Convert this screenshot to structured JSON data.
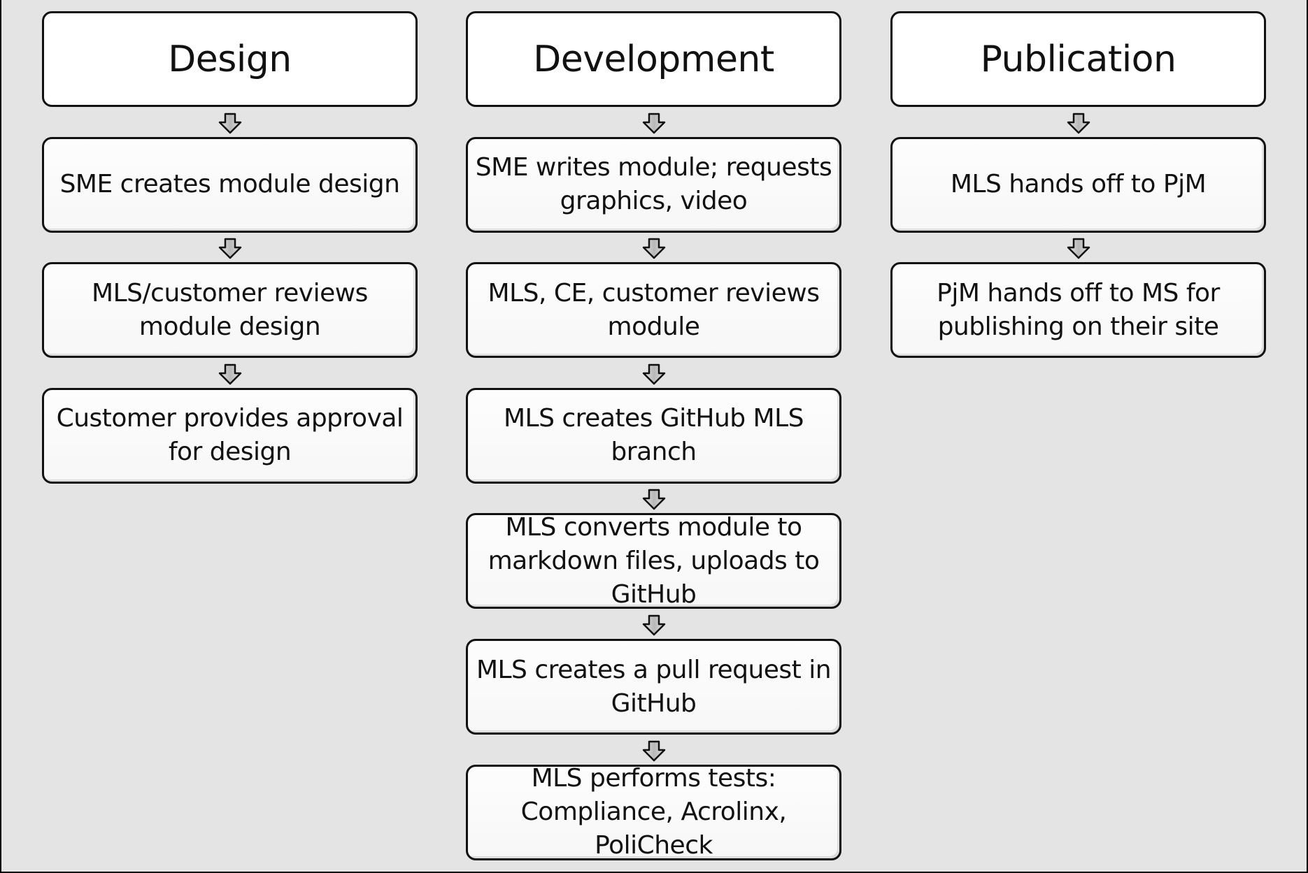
{
  "diagram": {
    "type": "process-flow",
    "columns": [
      {
        "title": "Design",
        "steps": [
          "SME creates module design",
          "MLS/customer reviews module design",
          "Customer provides approval for design"
        ]
      },
      {
        "title": "Development",
        "steps": [
          "SME writes module; requests graphics, video",
          "MLS, CE, customer reviews module",
          "MLS creates GitHub MLS branch",
          "MLS converts module to markdown files, uploads to GitHub",
          "MLS creates a pull request in GitHub",
          "MLS performs tests: Compliance, Acrolinx, PoliCheck"
        ]
      },
      {
        "title": "Publication",
        "steps": [
          "MLS hands off to PjM",
          "PjM hands off to MS for publishing on their site"
        ]
      }
    ],
    "colors": {
      "background": "#e4e4e4",
      "box_fill": "#ffffff",
      "box_border": "#111111",
      "arrow_fill": "#c8c8c8"
    },
    "connector_icon": "down-arrow-icon"
  }
}
